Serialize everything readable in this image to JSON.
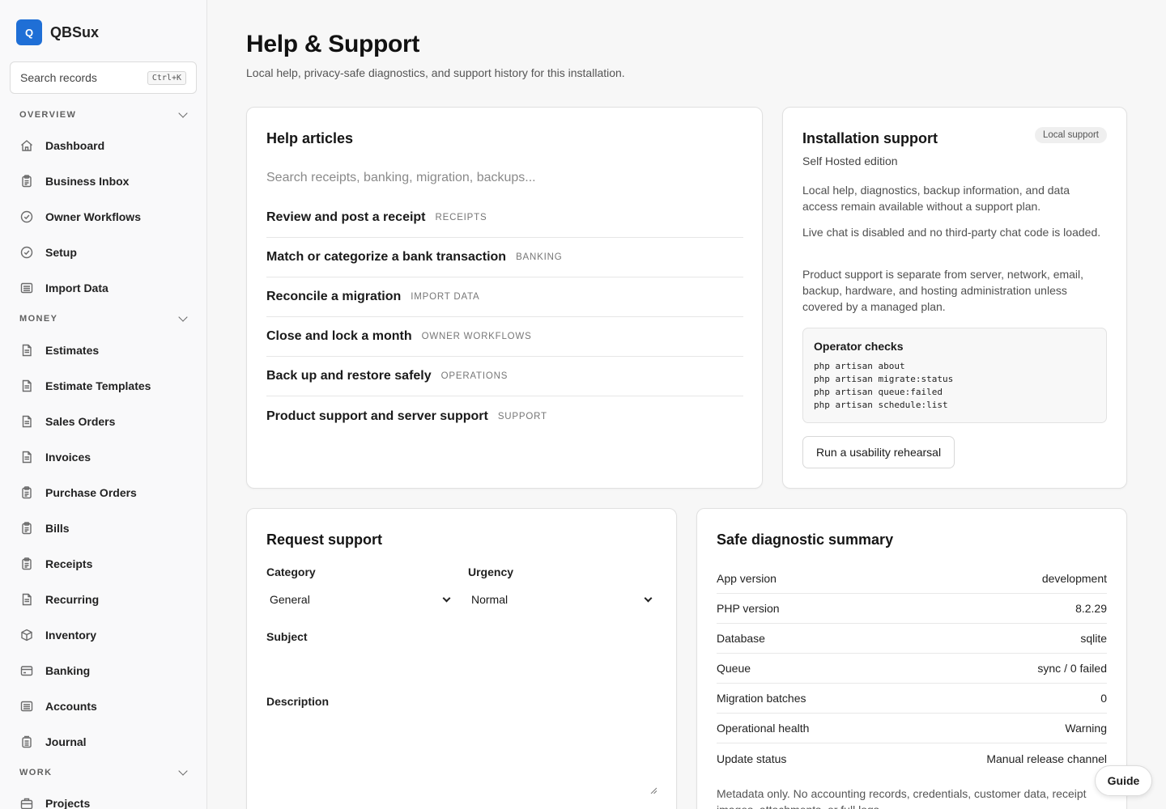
{
  "app": {
    "logo_letter": "Q",
    "name": "QBSux",
    "brand_color": "#1f6fd6"
  },
  "sidebar": {
    "search": {
      "label": "Search records",
      "shortcut": "Ctrl+K"
    },
    "sections": [
      {
        "title": "OVERVIEW",
        "items": [
          {
            "label": "Dashboard",
            "icon": "home-icon"
          },
          {
            "label": "Business Inbox",
            "icon": "clipboard-icon"
          },
          {
            "label": "Owner Workflows",
            "icon": "check-circle-icon"
          },
          {
            "label": "Setup",
            "icon": "check-circle-icon"
          },
          {
            "label": "Import Data",
            "icon": "list-box-icon"
          }
        ]
      },
      {
        "title": "MONEY",
        "items": [
          {
            "label": "Estimates",
            "icon": "document-icon"
          },
          {
            "label": "Estimate Templates",
            "icon": "document-icon"
          },
          {
            "label": "Sales Orders",
            "icon": "document-icon"
          },
          {
            "label": "Invoices",
            "icon": "document-icon"
          },
          {
            "label": "Purchase Orders",
            "icon": "clipboard-icon"
          },
          {
            "label": "Bills",
            "icon": "clipboard-icon"
          },
          {
            "label": "Receipts",
            "icon": "clipboard-icon"
          },
          {
            "label": "Recurring",
            "icon": "document-icon"
          },
          {
            "label": "Inventory",
            "icon": "box-icon"
          },
          {
            "label": "Banking",
            "icon": "bank-icon"
          },
          {
            "label": "Accounts",
            "icon": "list-box-icon"
          },
          {
            "label": "Journal",
            "icon": "journal-icon"
          }
        ]
      },
      {
        "title": "WORK",
        "items": [
          {
            "label": "Projects",
            "icon": "briefcase-icon"
          }
        ]
      }
    ]
  },
  "header": {
    "title": "Help & Support",
    "subtitle": "Local help, privacy-safe diagnostics, and support history for this installation."
  },
  "help_articles": {
    "title": "Help articles",
    "search_placeholder": "Search receipts, banking, migration, backups...",
    "articles": [
      {
        "title": "Review and post a receipt",
        "tag": "RECEIPTS"
      },
      {
        "title": "Match or categorize a bank transaction",
        "tag": "BANKING"
      },
      {
        "title": "Reconcile a migration",
        "tag": "IMPORT DATA"
      },
      {
        "title": "Close and lock a month",
        "tag": "OWNER WORKFLOWS"
      },
      {
        "title": "Back up and restore safely",
        "tag": "OPERATIONS"
      },
      {
        "title": "Product support and server support",
        "tag": "SUPPORT"
      }
    ]
  },
  "installation": {
    "title": "Installation support",
    "badge": "Local support",
    "edition": "Self Hosted edition",
    "paragraphs": [
      "Local help, diagnostics, backup information, and data access remain available without a support plan.",
      "Live chat is disabled and no third-party chat code is loaded.",
      "Product support is separate from server, network, email, backup, hardware, and hosting administration unless covered by a managed plan."
    ],
    "checks_title": "Operator checks",
    "checks": [
      "php artisan about",
      "php artisan migrate:status",
      "php artisan queue:failed",
      "php artisan schedule:list"
    ],
    "rehearsal_button": "Run a usability rehearsal"
  },
  "request": {
    "title": "Request support",
    "category_label": "Category",
    "category_value": "General",
    "urgency_label": "Urgency",
    "urgency_value": "Normal",
    "subject_label": "Subject",
    "description_label": "Description"
  },
  "diagnostics": {
    "title": "Safe diagnostic summary",
    "rows": [
      {
        "label": "App version",
        "value": "development"
      },
      {
        "label": "PHP version",
        "value": "8.2.29"
      },
      {
        "label": "Database",
        "value": "sqlite"
      },
      {
        "label": "Queue",
        "value": "sync / 0 failed"
      },
      {
        "label": "Migration batches",
        "value": "0"
      },
      {
        "label": "Operational health",
        "value": "Warning"
      },
      {
        "label": "Update status",
        "value": "Manual release channel"
      }
    ],
    "note": "Metadata only. No accounting records, credentials, customer data, receipt images, attachments, or full logs."
  },
  "guide_button": "Guide"
}
